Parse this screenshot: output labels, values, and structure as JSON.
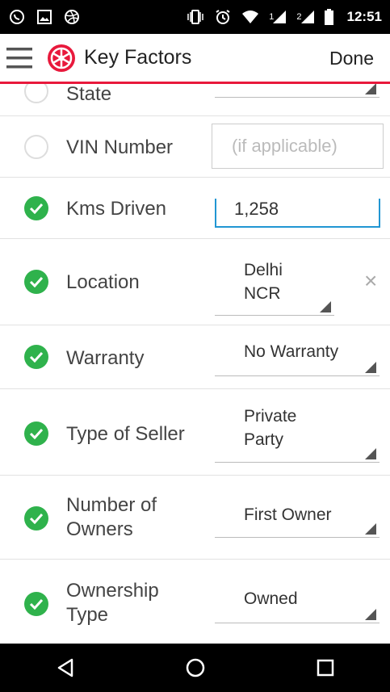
{
  "status_bar": {
    "time": "12:51",
    "sim1": "1",
    "sim2": "2",
    "icons": [
      "whatsapp-icon",
      "image-icon",
      "dribbble-icon",
      "vibrate-icon",
      "alarm-icon",
      "wifi-icon",
      "signal-icon",
      "battery-icon"
    ]
  },
  "app_bar": {
    "title": "Key Factors",
    "done_label": "Done",
    "accent": "#e8193c"
  },
  "rows": {
    "state": {
      "label": "State"
    },
    "vin": {
      "label": "VIN Number",
      "placeholder": "(if applicable)",
      "value": ""
    },
    "kms": {
      "label": "Kms Driven",
      "value": "1,258"
    },
    "location": {
      "label": "Location",
      "value_line1": "Delhi",
      "value_line2": "NCR",
      "clear": "×"
    },
    "warranty": {
      "label": "Warranty",
      "value": "No Warranty"
    },
    "seller": {
      "label": "Type of Seller",
      "value_line1": "Private",
      "value_line2": "Party"
    },
    "owners": {
      "label_line1": "Number of",
      "label_line2": "Owners",
      "value": "First Owner"
    },
    "ownership": {
      "label_line1": "Ownership",
      "label_line2": "Type",
      "value": "Owned"
    }
  },
  "colors": {
    "check": "#2fb24c",
    "focus": "#2196d3"
  },
  "nav": {
    "icons": [
      "back-icon",
      "home-icon",
      "recents-icon"
    ]
  }
}
